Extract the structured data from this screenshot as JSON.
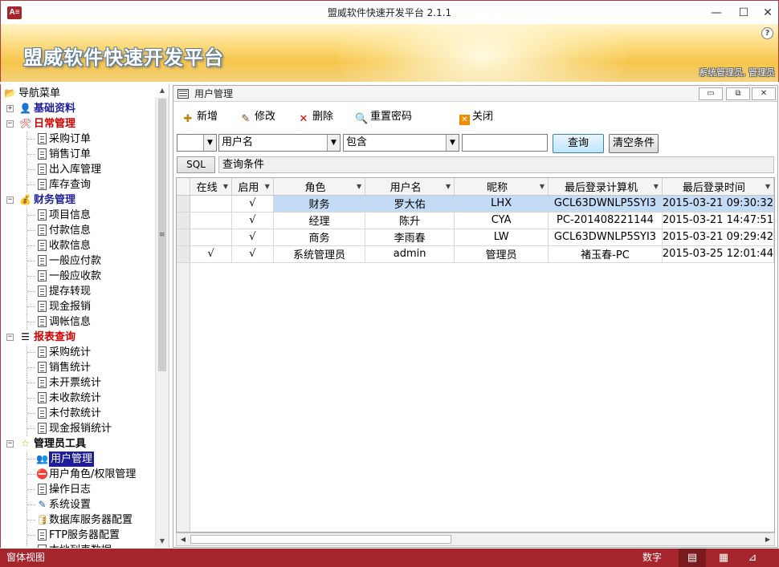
{
  "window": {
    "title": "盟威软件快速开发平台 2.1.1",
    "app_icon": "A≡",
    "minimize": "—",
    "maximize": "☐",
    "close": "✕"
  },
  "banner": {
    "brand": "盟威软件快速开发平台",
    "help": "?",
    "user": "系统管理员, 管理员"
  },
  "nav": {
    "title": "导航菜单",
    "groups": [
      {
        "label": "基础资料",
        "color": "#1f1f9a",
        "icon": "person-icon",
        "expanded": false,
        "items": []
      },
      {
        "label": "日常管理",
        "color": "#d40000",
        "icon": "tools-icon",
        "expanded": true,
        "items": [
          "采购订单",
          "销售订单",
          "出入库管理",
          "库存查询"
        ]
      },
      {
        "label": "财务管理",
        "color": "#1f1f9a",
        "icon": "money-icon",
        "expanded": true,
        "items": [
          "项目信息",
          "付款信息",
          "收款信息",
          "一般应付款",
          "一般应收款",
          "提存转现",
          "现金报销",
          "调帐信息"
        ]
      },
      {
        "label": "报表查询",
        "color": "#d40000",
        "icon": "list-icon",
        "expanded": true,
        "items": [
          "采购统计",
          "销售统计",
          "未开票统计",
          "未收款统计",
          "未付款统计",
          "现金报销统计"
        ]
      },
      {
        "label": "管理员工具",
        "color": "#000000",
        "icon": "star-icon",
        "expanded": true,
        "items": [
          "用户管理",
          "用户角色/权限管理",
          "操作日志",
          "系统设置",
          "数据库服务器配置",
          "FTP服务器配置",
          "本地列表数据"
        ]
      }
    ],
    "selected": "用户管理"
  },
  "doc": {
    "title": "用户管理",
    "btn_min": "▭",
    "btn_restore": "⧉",
    "btn_close": "✕",
    "toolbar": {
      "add": "新增",
      "edit": "修改",
      "delete": "删除",
      "reset": "重置密码",
      "close": "关闭"
    },
    "filter": {
      "first": "",
      "field": "用户名",
      "op": "包含",
      "value": "",
      "query": "查询",
      "clear": "清空条件"
    },
    "sql": {
      "button": "SQL",
      "condition": "查询条件"
    },
    "columns": [
      "在线",
      "启用",
      "角色",
      "用户名",
      "昵称",
      "最后登录计算机",
      "最后登录时间"
    ],
    "rows": [
      [
        "",
        "√",
        "财务",
        "罗大佑",
        "LHX",
        "GCL63DWNLP5SYI3",
        "2015-03-21 09:30:32"
      ],
      [
        "",
        "√",
        "经理",
        "陈升",
        "CYA",
        "PC-201408221144",
        "2015-03-21 14:47:51"
      ],
      [
        "",
        "√",
        "商务",
        "李雨春",
        "LW",
        "GCL63DWNLP5SYI3",
        "2015-03-21 09:29:42"
      ],
      [
        "√",
        "√",
        "系统管理员",
        "admin",
        "管理员",
        "褚玉春-PC",
        "2015-03-25 12:01:44"
      ]
    ]
  },
  "status": {
    "left": "窗体视图",
    "numlock": "数字"
  },
  "colors": {
    "accent": "#a4262c",
    "selection": "#c3dbf4"
  }
}
